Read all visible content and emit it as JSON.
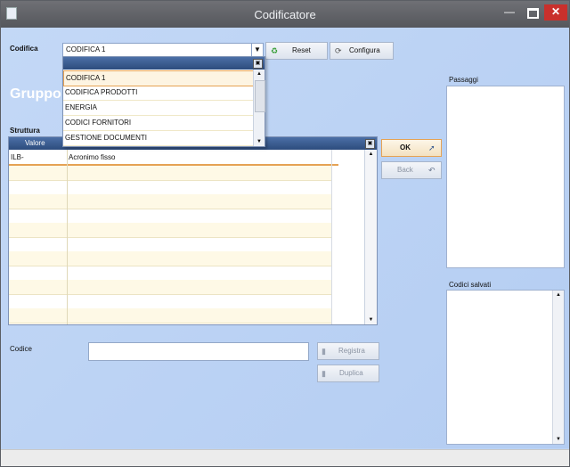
{
  "window": {
    "title": "Codificatore",
    "minimize_glyph": "—",
    "close_glyph": "✕"
  },
  "codifica": {
    "label": "Codifica",
    "selected": "CODIFICA 1",
    "options": [
      "CODIFICA 1",
      "CODIFICA PRODOTTI",
      "ENERGIA",
      "CODICI FORNITORI",
      "GESTIONE DOCUMENTI"
    ]
  },
  "toolbar": {
    "reset_label": "Reset",
    "configura_label": "Configura"
  },
  "group_title": "Gruppo",
  "struttura": {
    "label": "Struttura",
    "column_valore": "Valore",
    "rows": [
      {
        "code": "ILB-",
        "description": "Acronimo fisso"
      }
    ]
  },
  "actions": {
    "ok_label": "OK",
    "back_label": "Back"
  },
  "passaggi": {
    "label": "Passaggi"
  },
  "codici_salvati": {
    "label": "Codici salvati"
  },
  "codice": {
    "label": "Codice",
    "value": ""
  },
  "buttons": {
    "registra_label": "Registra",
    "duplica_label": "Duplica"
  },
  "icons": {
    "app": "document-icon",
    "reset": "refresh-green-icon",
    "configura": "gear-icon",
    "ok": "arrow-right-icon",
    "back": "arrow-back-icon",
    "registra": "document-icon",
    "duplica": "document-icon"
  },
  "colors": {
    "titlebar": "#5d5f64",
    "close": "#c9302c",
    "background": "#bdd4f4",
    "header": "#3a5b8f",
    "selection": "#e5a254",
    "row_alt": "#fef9e6"
  }
}
